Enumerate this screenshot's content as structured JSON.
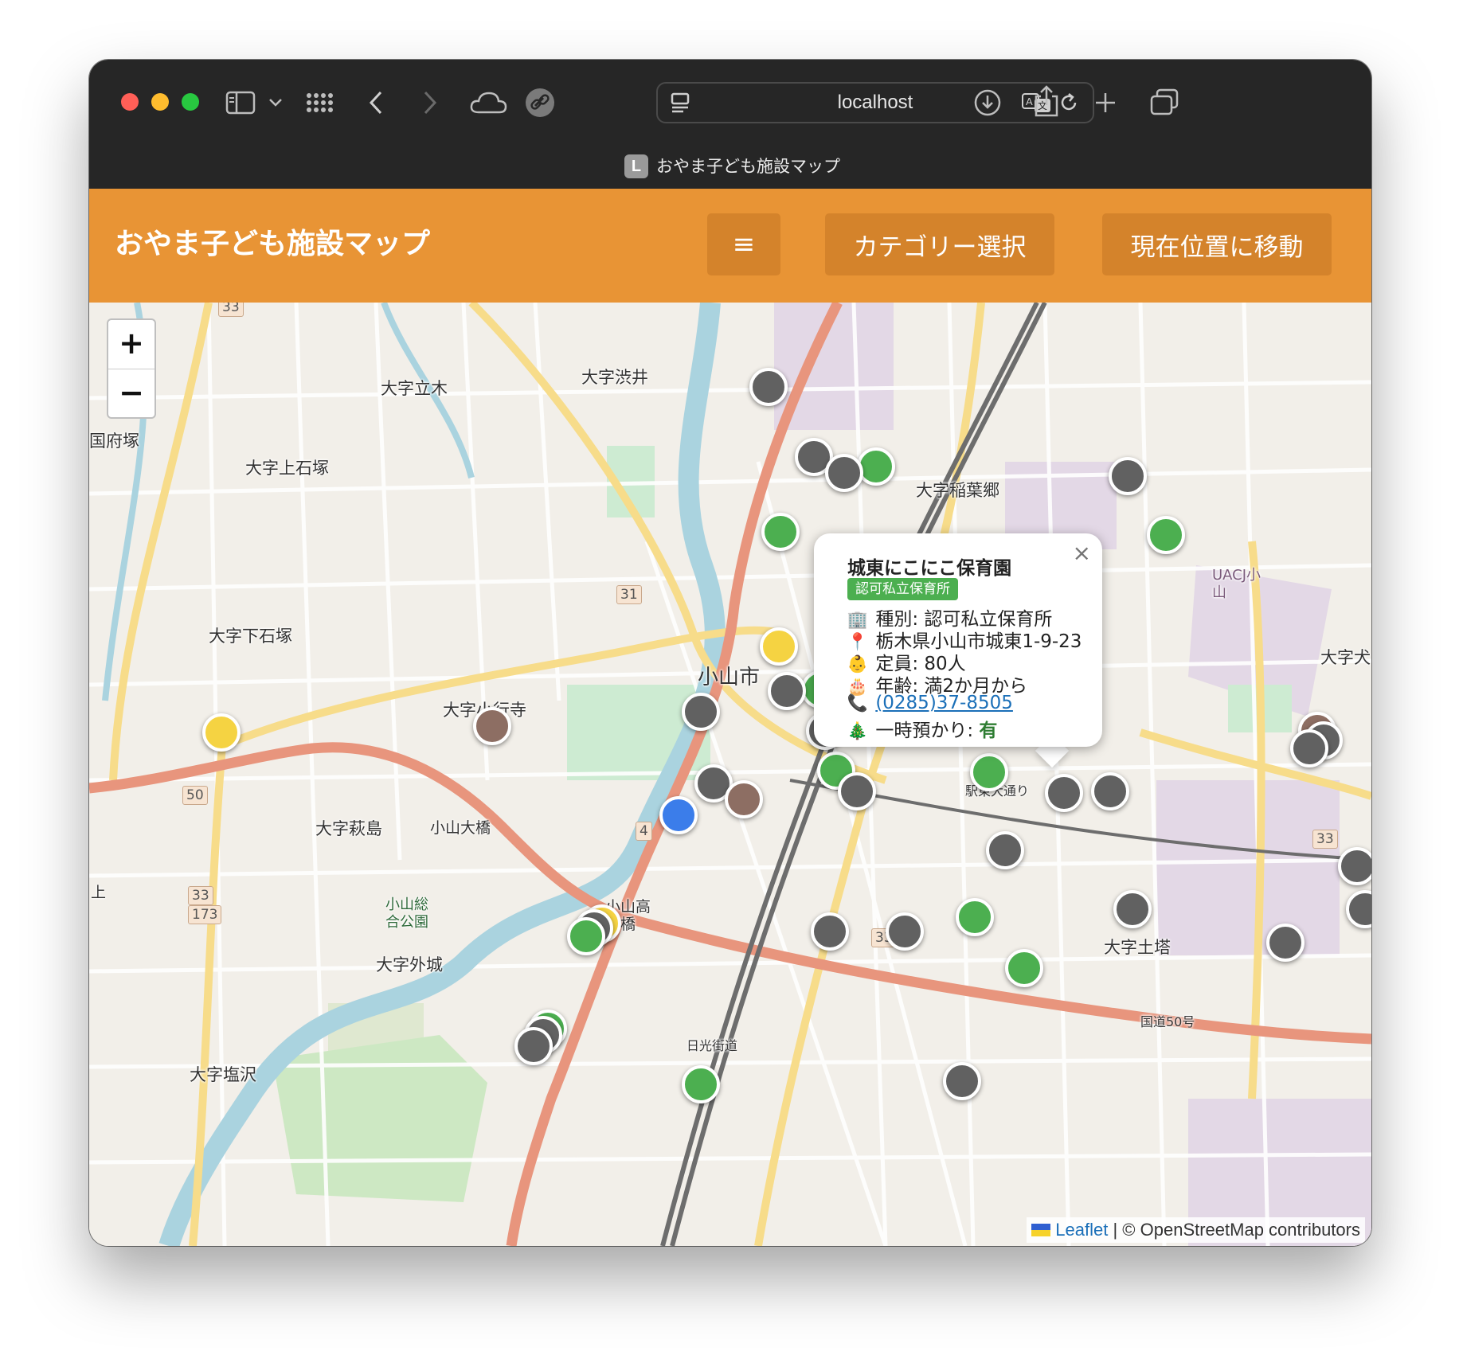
{
  "browser": {
    "url": "localhost",
    "tab_favicon_letter": "L",
    "tab_title": "おやま子ども施設マップ"
  },
  "header": {
    "title": "おやま子ども施設マップ",
    "menu_icon": "≡",
    "category_button": "カテゴリー選択",
    "location_button": "現在位置に移動",
    "color": "#e89435"
  },
  "map": {
    "zoom_in": "+",
    "zoom_out": "−",
    "place_labels": [
      "大字渋井",
      "大字立木",
      "国府塚",
      "大字上石塚",
      "大字稲葉郷",
      "大字下石塚",
      "小山市",
      "大字小行寺",
      "大字萩島",
      "小山大橋",
      "大字外城",
      "大字塩沢",
      "大字土塔",
      "大字犬",
      "小山総合公園",
      "小山高架橋",
      "UACJ小山",
      "駅東大通り",
      "国道50号",
      "日光街道",
      "上"
    ],
    "route_shields": [
      "33",
      "31",
      "50",
      "4",
      "33",
      "173",
      "33",
      "33"
    ],
    "marker_colors": {
      "gray": "#616161",
      "green": "#4caf50",
      "yellow": "#f5d342",
      "brown": "#8d6e63",
      "blue": "#3b7dea"
    },
    "attribution": {
      "leaflet": "Leaflet",
      "rest": " | © OpenStreetMap contributors"
    }
  },
  "popup": {
    "close": "×",
    "title": "城東にこにこ保育園",
    "badge": "認可私立保育所",
    "type_icon": "🏢",
    "type": "種別: 認可私立保育所",
    "address_icon": "📍",
    "address": "栃木県小山市城東1-9-23",
    "capacity_icon": "👶",
    "capacity": "定員: 80人",
    "age_icon": "🎂",
    "age": "年齢: 満2か月から",
    "phone_icon": "📞",
    "phone": "(0285)37-8505",
    "temp_icon": "🎄",
    "temp_label": "一時預かり: ",
    "temp_value": "有"
  }
}
